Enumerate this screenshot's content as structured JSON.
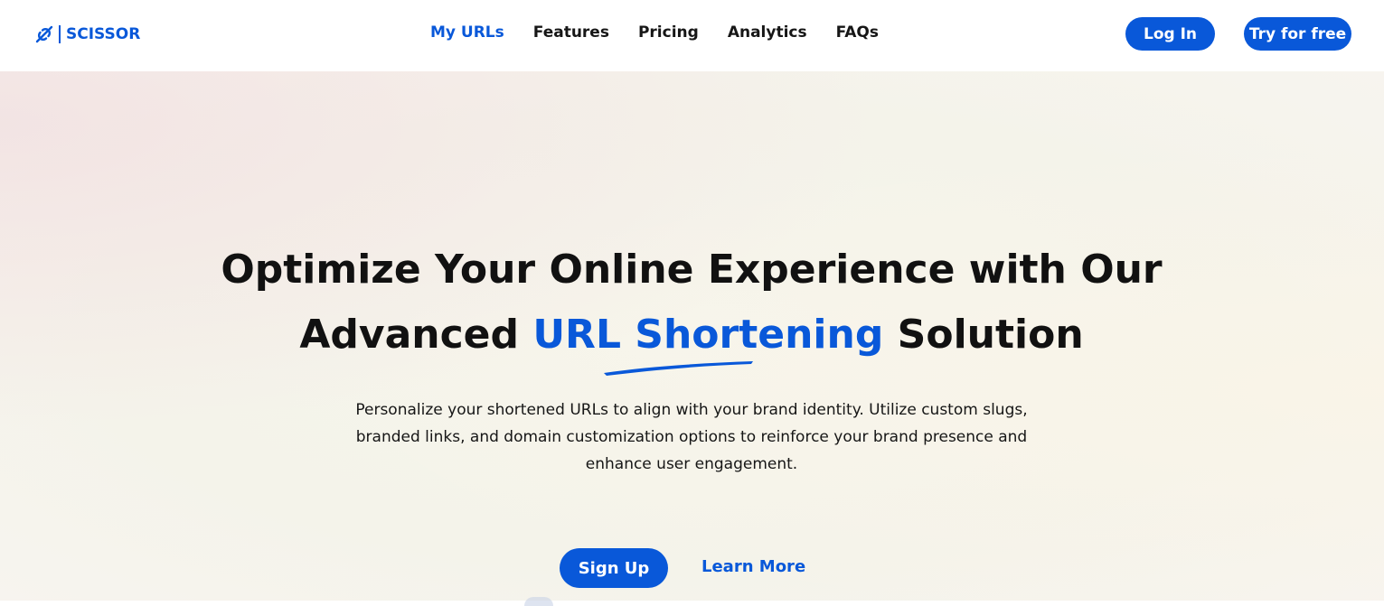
{
  "brand": {
    "name": "SCISSOR",
    "logo_icon": "link-slash-icon",
    "color": "#0958d9"
  },
  "nav": {
    "items": [
      {
        "label": "My URLs",
        "active": true
      },
      {
        "label": "Features",
        "active": false
      },
      {
        "label": "Pricing",
        "active": false
      },
      {
        "label": "Analytics",
        "active": false
      },
      {
        "label": "FAQs",
        "active": false
      }
    ],
    "login_label": "Log In",
    "try_label": "Try for free"
  },
  "hero": {
    "headline_line1": "Optimize Your Online Experience with Our",
    "headline_line2_prefix": "Advanced ",
    "headline_accent": "URL Shortening",
    "headline_line2_suffix": " Solution",
    "subtitle_line1": "Personalize your shortened URLs to align with your brand identity. Utilize custom slugs,",
    "subtitle_line2": "branded links, and domain customization options to reinforce your brand presence and",
    "subtitle_line3": "enhance user engagement.",
    "signup_label": "Sign Up",
    "learn_more_label": "Learn More"
  },
  "colors": {
    "accent": "#0958d9",
    "text": "#111111"
  }
}
